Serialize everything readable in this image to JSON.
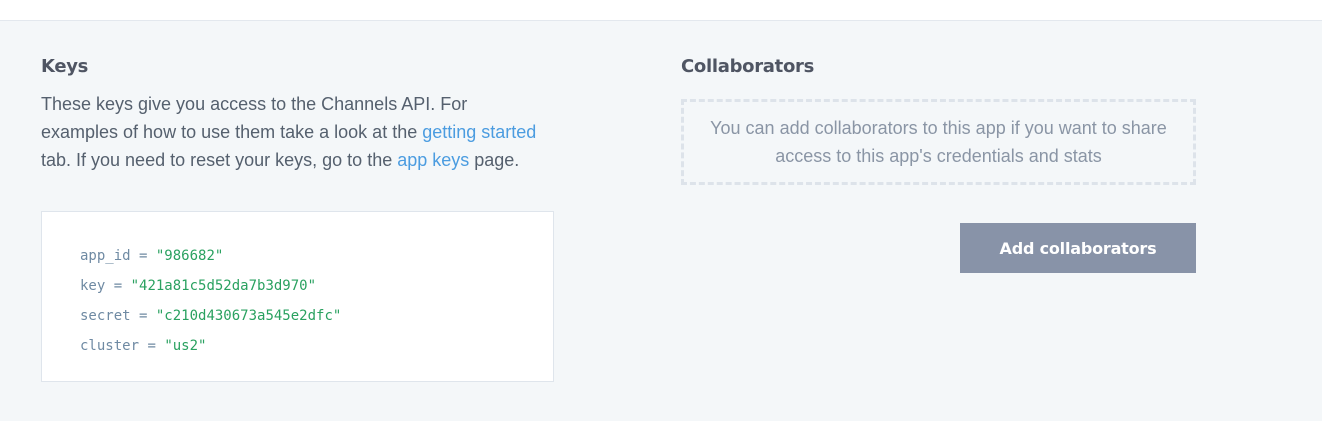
{
  "keys": {
    "title": "Keys",
    "description_part1": "These keys give you access to the Channels API. For examples of how to use them take a look at the ",
    "link_getting_started": "getting started",
    "description_part2": " tab. If you need to reset your keys, go to the ",
    "link_app_keys": "app keys",
    "description_part3": " page.",
    "code": [
      {
        "key": "app_id",
        "op": " = ",
        "value": "\"986682\""
      },
      {
        "key": "key",
        "op": " = ",
        "value": "\"421a81c5d52da7b3d970\""
      },
      {
        "key": "secret",
        "op": " = ",
        "value": "\"c210d430673a545e2dfc\""
      },
      {
        "key": "cluster",
        "op": " = ",
        "value": "\"us2\""
      }
    ]
  },
  "collaborators": {
    "title": "Collaborators",
    "empty_message": "You can add collaborators to this app if you want to share access to this app's credentials and stats",
    "add_button_label": "Add collaborators"
  },
  "colors": {
    "background": "#f4f7f9",
    "link": "#4b9ce0",
    "code_value": "#2aa160",
    "code_key": "#6f8aa3",
    "button": "#8893a8"
  }
}
